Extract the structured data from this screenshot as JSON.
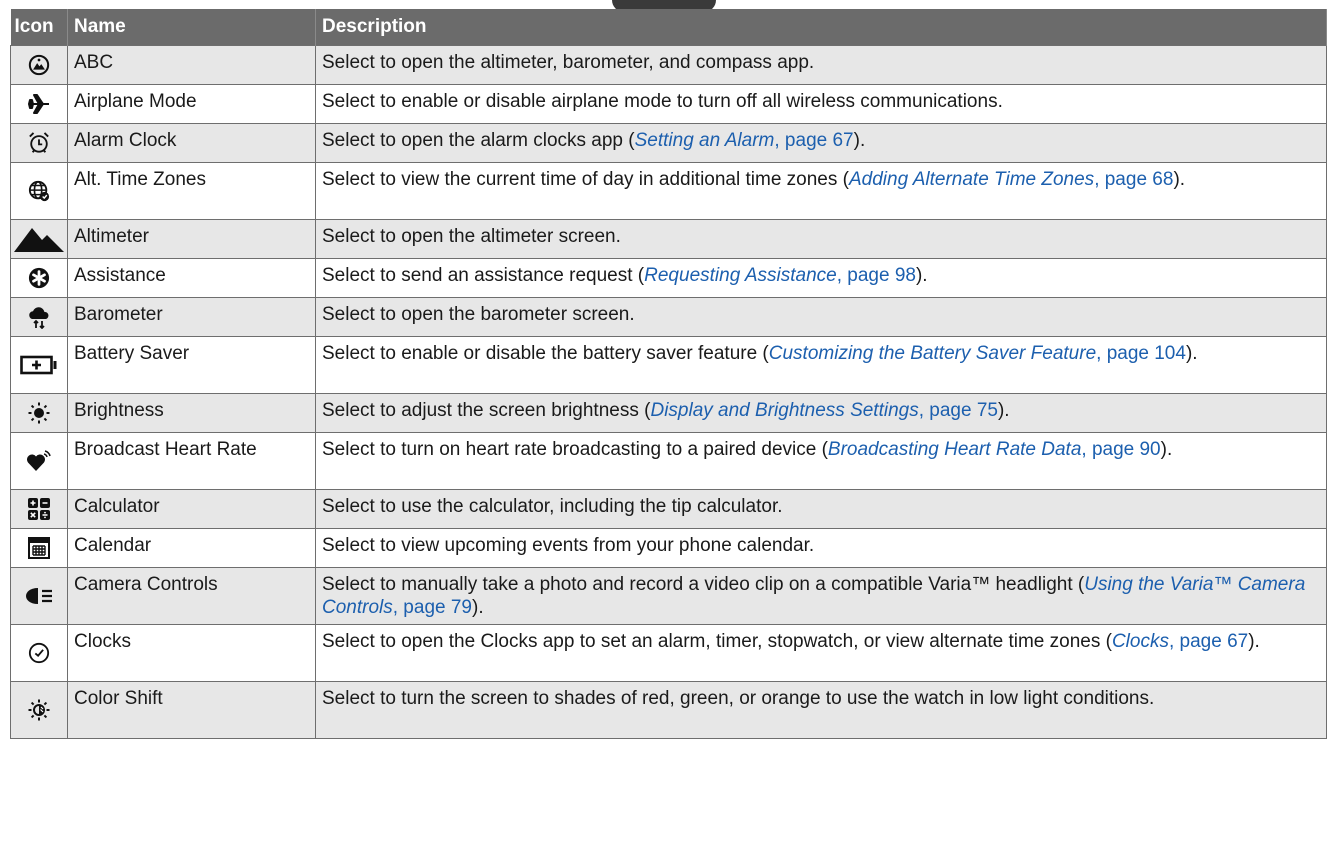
{
  "header": {
    "icon": "Icon",
    "name": "Name",
    "description": "Description"
  },
  "rows": [
    {
      "icon": "altimeter-barometer-compass-icon",
      "name": "ABC",
      "desc": [
        "Select to open the altimeter, barometer, and compass app."
      ]
    },
    {
      "icon": "airplane-icon",
      "name": "Airplane Mode",
      "desc": [
        "Select to enable or disable airplane mode to turn off all wireless communications."
      ]
    },
    {
      "icon": "alarm-clock-icon",
      "name": "Alarm Clock",
      "desc": [
        "Select to open the alarm clocks app (",
        "Setting an Alarm",
        ", page 67",
        ")."
      ]
    },
    {
      "icon": "globe-clock-icon",
      "name": "Alt. Time Zones",
      "desc": [
        "Select to view the current time of day in additional time zones (",
        "Adding Alternate Time Zones",
        ", page 68",
        ")."
      ]
    },
    {
      "icon": "mountain-icon",
      "name": "Altimeter",
      "desc": [
        "Select to open the altimeter screen."
      ]
    },
    {
      "icon": "assistance-icon",
      "name": "Assistance",
      "desc": [
        "Select to send an assistance request (",
        "Requesting Assistance",
        ", page 98",
        ")."
      ]
    },
    {
      "icon": "cloud-arrows-icon",
      "name": "Barometer",
      "desc": [
        "Select to open the barometer screen."
      ]
    },
    {
      "icon": "battery-plus-icon",
      "name": "Battery Saver",
      "desc": [
        "Select to enable or disable the battery saver feature (",
        "Customizing the Battery Saver Feature",
        ", page 104",
        ")."
      ]
    },
    {
      "icon": "brightness-sun-icon",
      "name": "Brightness",
      "desc": [
        "Select to adjust the screen brightness (",
        "Display and Brightness Settings",
        ", page 75",
        ")."
      ]
    },
    {
      "icon": "heart-broadcast-icon",
      "name": "Broadcast Heart Rate",
      "desc": [
        "Select to turn on heart rate broadcasting to a paired device (",
        "Broadcasting Heart Rate Data",
        ", page 90",
        ")."
      ]
    },
    {
      "icon": "calculator-icon",
      "name": "Calculator",
      "desc": [
        "Select to use the calculator, including the tip calculator."
      ]
    },
    {
      "icon": "calendar-icon",
      "name": "Calendar",
      "desc": [
        "Select to view upcoming events from your phone calendar."
      ]
    },
    {
      "icon": "headlight-camera-icon",
      "name": "Camera Controls",
      "desc": [
        "Select to manually take a photo and record a video clip on a compatible Varia™ headlight (",
        "Using the Varia™ Camera Controls",
        ", page 79",
        ")."
      ]
    },
    {
      "icon": "clock-icon",
      "name": "Clocks",
      "desc": [
        "Select to open the Clocks app to set an alarm, timer, stopwatch, or view alternate time zones (",
        "Clocks",
        ", page 67",
        ")."
      ]
    },
    {
      "icon": "color-shift-icon",
      "name": "Color Shift",
      "desc": [
        "Select to turn the screen to shades of red, green, or orange to use the watch in low light conditions."
      ]
    }
  ]
}
